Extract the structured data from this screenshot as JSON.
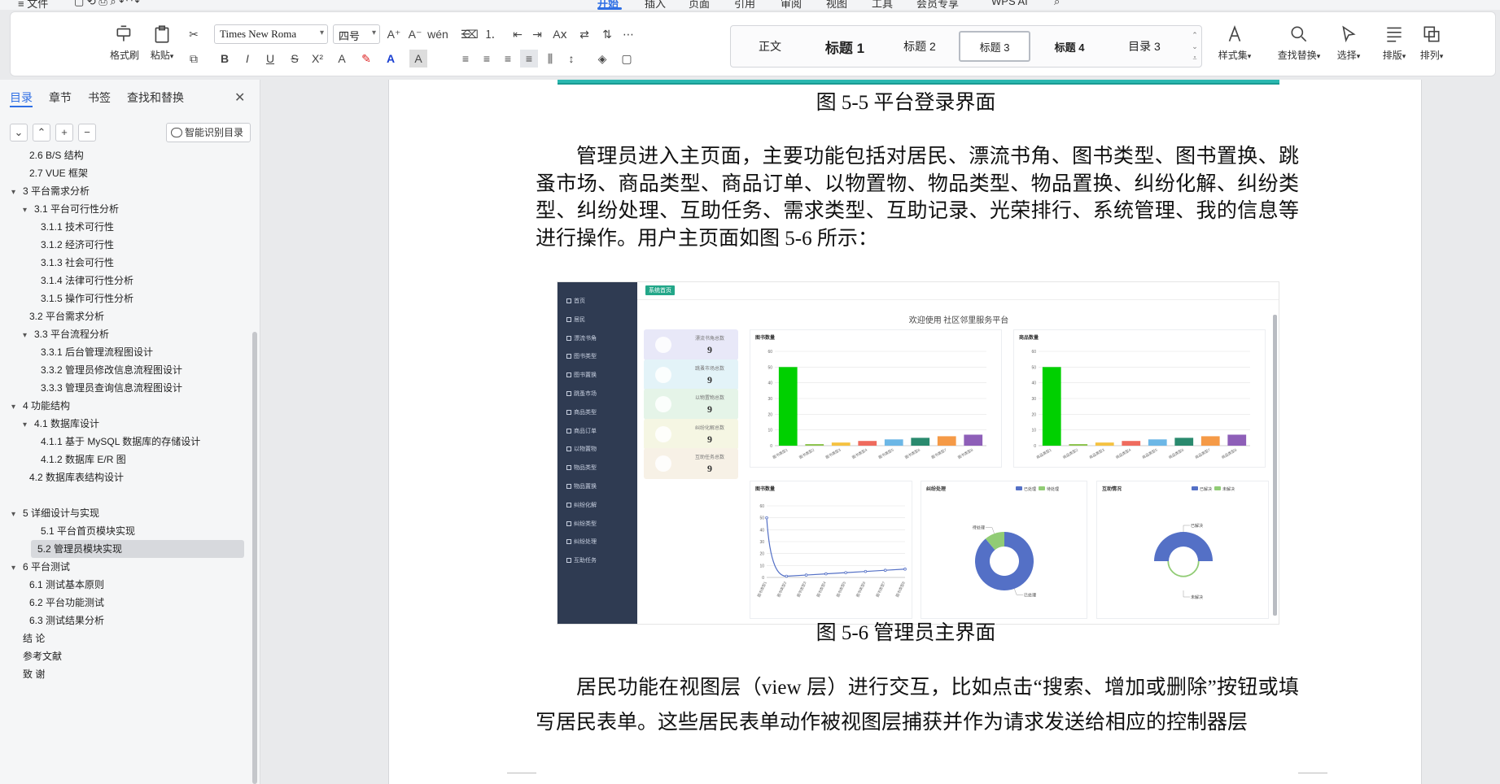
{
  "topbar": {
    "tabs": [
      "≡ 文件",
      "开始",
      "插入",
      "页面",
      "引用",
      "审阅",
      "视图",
      "工具",
      "会员专享",
      "WPS AI"
    ],
    "active_tab": "开始"
  },
  "ribbon": {
    "format_painter": "格式刷",
    "paste": "粘贴",
    "font_name": "Times New Roma",
    "font_size": "四号",
    "styles": [
      "正文",
      "标题 1",
      "标题 2",
      "标题 3",
      "标题 4",
      "目录 3"
    ],
    "selected_style": "标题 3",
    "style_set": "样式集",
    "find_replace": "查找替换",
    "select": "选择",
    "typeset": "排版",
    "arrange": "排列"
  },
  "navpane": {
    "tabs": [
      "目录",
      "章节",
      "书签",
      "查找和替换"
    ],
    "active_tab": "目录",
    "smart_toc_button": "智能识别目录",
    "toc": [
      {
        "label": "2.6 B/S 结构",
        "level": 2
      },
      {
        "label": "2.7 VUE 框架",
        "level": 2
      },
      {
        "label": "3 平台需求分析",
        "level": 1,
        "expanded": true
      },
      {
        "label": "3.1 平台可行性分析",
        "level": 2,
        "expanded": true
      },
      {
        "label": "3.1.1 技术可行性",
        "level": 3
      },
      {
        "label": "3.1.2 经济可行性",
        "level": 3
      },
      {
        "label": "3.1.3 社会可行性",
        "level": 3
      },
      {
        "label": "3.1.4 法律可行性分析",
        "level": 3
      },
      {
        "label": "3.1.5 操作可行性分析",
        "level": 3
      },
      {
        "label": "3.2  平台需求分析",
        "level": 2
      },
      {
        "label": "3.3  平台流程分析",
        "level": 2,
        "expanded": true
      },
      {
        "label": "3.3.1 后台管理流程图设计",
        "level": 3
      },
      {
        "label": "3.3.2 管理员修改信息流程图设计",
        "level": 3
      },
      {
        "label": "3.3.3 管理员查询信息流程图设计",
        "level": 3
      },
      {
        "label": "4 功能结构",
        "level": 1,
        "expanded": true
      },
      {
        "label": "4.1  数据库设计",
        "level": 2,
        "expanded": true
      },
      {
        "label": "4.1.1  基于 MySQL 数据库的存储设计",
        "level": 3
      },
      {
        "label": "4.1.2  数据库 E/R 图",
        "level": 3
      },
      {
        "label": "4.2  数据库表结构设计",
        "level": 2
      },
      {
        "label": "",
        "level": 1
      },
      {
        "label": "5 详细设计与实现",
        "level": 1,
        "expanded": true
      },
      {
        "label": "5.1 平台首页模块实现",
        "level": 3
      },
      {
        "label": "5.2 管理员模块实现",
        "level": 3,
        "selected": true
      },
      {
        "label": "6  平台测试",
        "level": 1,
        "expanded": true
      },
      {
        "label": "6.1  测试基本原则",
        "level": 2
      },
      {
        "label": "6.2  平台功能测试",
        "level": 2
      },
      {
        "label": "6.3  测试结果分析",
        "level": 2
      },
      {
        "label": "结  论",
        "level": 1
      },
      {
        "label": "参考文献",
        "level": 1
      },
      {
        "label": "致  谢",
        "level": 1
      }
    ]
  },
  "document": {
    "caption_1": "图 5-5 平台登录界面",
    "paragraph_1": "管理员进入主页面，主要功能包括对居民、漂流书角、图书类型、图书置换、跳蚤市场、商品类型、商品订单、以物置物、物品类型、物品置换、纠纷化解、纠纷类型、纠纷处理、互助任务、需求类型、互助记录、光荣排行、系统管理、我的信息等进行操作。用户主页面如图 5-6 所示：",
    "caption_2": "图 5-6 管理员主界面",
    "paragraph_2": "居民功能在视图层（view 层）进行交互，比如点击“搜索、增加或删除”按钮或填写居民表单。这些居民表单动作被视图层捕获并作为请求发送给相应的控制器层"
  },
  "figure": {
    "badge": "系统首页",
    "welcome": "欢迎使用 社区邻里服务平台",
    "menu": [
      "首页",
      "居民",
      "漂流书角",
      "图书类型",
      "图书置换",
      "跳蚤市场",
      "商品类型",
      "商品订单",
      "以物置物",
      "物品类型",
      "物品置换",
      "纠纷化解",
      "纠纷类型",
      "纠纷处理",
      "互助任务"
    ],
    "stats": [
      {
        "label": "漂流书角总数",
        "value": "9",
        "color": "#e8e8f8"
      },
      {
        "label": "跳蚤市场总数",
        "value": "9",
        "color": "#e3f3f8"
      },
      {
        "label": "以物置物总数",
        "value": "9",
        "color": "#e5f4e8"
      },
      {
        "label": "纠纷化解总数",
        "value": "9",
        "color": "#f5f6e3"
      },
      {
        "label": "互助任务总数",
        "value": "9",
        "color": "#f7f1e6"
      }
    ],
    "panel_titles": [
      "图书数量",
      "商品数量",
      "图书数量",
      "纠纷处理",
      "互助情况"
    ],
    "donut_legend_1": [
      "已处理",
      "待处理"
    ],
    "donut_labels_1": [
      "待处理",
      "已处理"
    ],
    "donut_legend_2": [
      "已解决",
      "未解决"
    ],
    "donut_labels_2": [
      "未解决",
      "已解决"
    ]
  },
  "chart_data": [
    {
      "type": "bar",
      "title": "图书数量",
      "categories": [
        "图书类型1",
        "图书类型2",
        "图书类型3",
        "图书类型4",
        "图书类型5",
        "图书类型6",
        "图书类型7",
        "图书类型8"
      ],
      "values": [
        50,
        1,
        2,
        3,
        4,
        5,
        6,
        7
      ],
      "colors": [
        "#00d000",
        "#8bc34a",
        "#f5c242",
        "#ef6b5e",
        "#6cb7e6",
        "#2a8a6e",
        "#f59a47",
        "#8e5fb8"
      ],
      "ylim": [
        0,
        60
      ],
      "yticks": [
        0,
        10,
        20,
        30,
        40,
        50,
        60
      ]
    },
    {
      "type": "bar",
      "title": "商品数量",
      "categories": [
        "商品类型1",
        "商品类型2",
        "商品类型3",
        "商品类型4",
        "商品类型5",
        "商品类型6",
        "商品类型7",
        "商品类型8"
      ],
      "values": [
        50,
        1,
        2,
        3,
        4,
        5,
        6,
        7
      ],
      "colors": [
        "#00d000",
        "#8bc34a",
        "#f5c242",
        "#ef6b5e",
        "#6cb7e6",
        "#2a8a6e",
        "#f59a47",
        "#8e5fb8"
      ],
      "ylim": [
        0,
        60
      ],
      "yticks": [
        0,
        10,
        20,
        30,
        40,
        50,
        60
      ]
    },
    {
      "type": "line",
      "title": "图书数量",
      "categories": [
        "图书类型1",
        "图书类型2",
        "图书类型3",
        "图书类型4",
        "图书类型5",
        "图书类型6",
        "图书类型7",
        "图书类型8"
      ],
      "values": [
        50,
        1,
        2,
        3,
        4,
        5,
        6,
        7
      ],
      "color": "#5470c6",
      "ylim": [
        0,
        60
      ],
      "yticks": [
        0,
        10,
        20,
        30,
        40,
        50,
        60
      ]
    },
    {
      "type": "pie",
      "title": "纠纷处理",
      "labels": [
        "已处理",
        "待处理"
      ],
      "values": [
        8,
        1
      ],
      "colors": [
        "#5470c6",
        "#91cc75"
      ]
    },
    {
      "type": "pie",
      "title": "互助情况",
      "labels": [
        "已解决",
        "未解决"
      ],
      "values": [
        1,
        1
      ],
      "colors": [
        "#5470c6",
        "#91cc75"
      ]
    }
  ]
}
